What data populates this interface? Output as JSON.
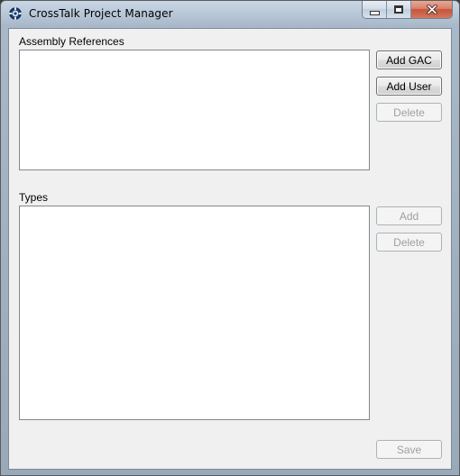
{
  "window": {
    "title": "CrossTalk Project Manager"
  },
  "icons": {
    "app": "gear-icon",
    "minimize": "minimize-icon",
    "maximize": "maximize-icon",
    "close": "close-icon"
  },
  "assembly_references": {
    "label": "Assembly References",
    "add_gac_label": "Add GAC",
    "add_user_label": "Add User",
    "delete_label": "Delete",
    "items": []
  },
  "types": {
    "label": "Types",
    "add_label": "Add",
    "delete_label": "Delete",
    "items": []
  },
  "footer": {
    "save_label": "Save"
  }
}
